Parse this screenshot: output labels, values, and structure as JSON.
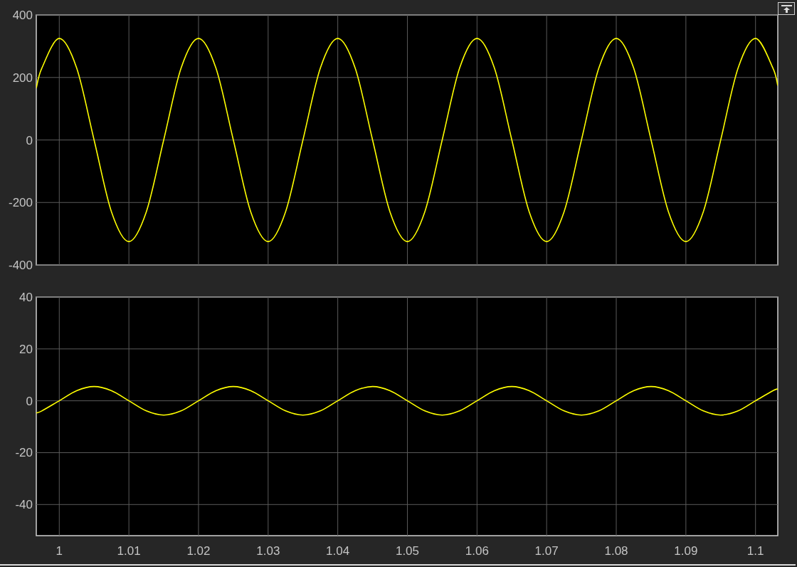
{
  "scopes": [
    {
      "chart_data": {
        "type": "line",
        "grid": true,
        "xlim": [
          0.9967,
          1.1032
        ],
        "ylim": [
          -400,
          400
        ],
        "yticks": [
          -400,
          -200,
          0,
          200,
          400
        ],
        "x": [
          0.9967,
          0.9975,
          1,
          1.0025,
          1.005,
          1.0075,
          1.01,
          1.0125,
          1.015,
          1.0175,
          1.02,
          1.0225,
          1.025,
          1.0275,
          1.03,
          1.0325,
          1.035,
          1.0375,
          1.04,
          1.0425,
          1.045,
          1.0475,
          1.05,
          1.0525,
          1.055,
          1.0575,
          1.06,
          1.0625,
          1.065,
          1.0675,
          1.07,
          1.0725,
          1.075,
          1.0775,
          1.08,
          1.0825,
          1.085,
          1.0875,
          1.09,
          1.0925,
          1.095,
          1.0975,
          1.1,
          1.1025,
          1.1032
        ],
        "series": [
          {
            "color": "#ffff00",
            "values": [
              166,
              230,
              325,
              230,
              0,
              -230,
              -325,
              -230,
              0,
              230,
              325,
              230,
              0,
              -230,
              -325,
              -230,
              0,
              230,
              325,
              230,
              0,
              -230,
              -325,
              -230,
              0,
              230,
              325,
              230,
              0,
              -230,
              -325,
              -230,
              0,
              230,
              325,
              230,
              0,
              -230,
              -325,
              -230,
              0,
              230,
              325,
              230,
              174
            ]
          }
        ]
      }
    },
    {
      "chart_data": {
        "type": "line",
        "grid": true,
        "xlim": [
          0.9967,
          1.1032
        ],
        "ylim": [
          -52,
          40
        ],
        "yticks": [
          -40,
          -20,
          0,
          20,
          40
        ],
        "xticks": [
          1,
          1.01,
          1.02,
          1.03,
          1.04,
          1.05,
          1.06,
          1.07,
          1.08,
          1.09,
          1.1
        ],
        "x": [
          0.9967,
          0.9975,
          1,
          1.0025,
          1.005,
          1.0075,
          1.01,
          1.0125,
          1.015,
          1.0175,
          1.02,
          1.0225,
          1.025,
          1.0275,
          1.03,
          1.0325,
          1.035,
          1.0375,
          1.04,
          1.0425,
          1.045,
          1.0475,
          1.05,
          1.0525,
          1.055,
          1.0575,
          1.06,
          1.0625,
          1.065,
          1.0675,
          1.07,
          1.0725,
          1.075,
          1.0775,
          1.08,
          1.0825,
          1.085,
          1.0875,
          1.09,
          1.0925,
          1.095,
          1.0975,
          1.1,
          1.1025,
          1.1032
        ],
        "series": [
          {
            "color": "#ffff00",
            "values": [
              -4.7,
              -3.9,
              0,
              3.9,
              5.5,
              3.9,
              0,
              -3.9,
              -5.5,
              -3.9,
              0,
              3.9,
              5.5,
              3.9,
              0,
              -3.9,
              -5.5,
              -3.9,
              0,
              3.9,
              5.5,
              3.9,
              0,
              -3.9,
              -5.5,
              -3.9,
              0,
              3.9,
              5.5,
              3.9,
              0,
              -3.9,
              -5.5,
              -3.9,
              0,
              3.9,
              5.5,
              3.9,
              0,
              -3.9,
              -5.5,
              -3.9,
              0,
              3.9,
              4.6
            ]
          }
        ]
      }
    }
  ]
}
